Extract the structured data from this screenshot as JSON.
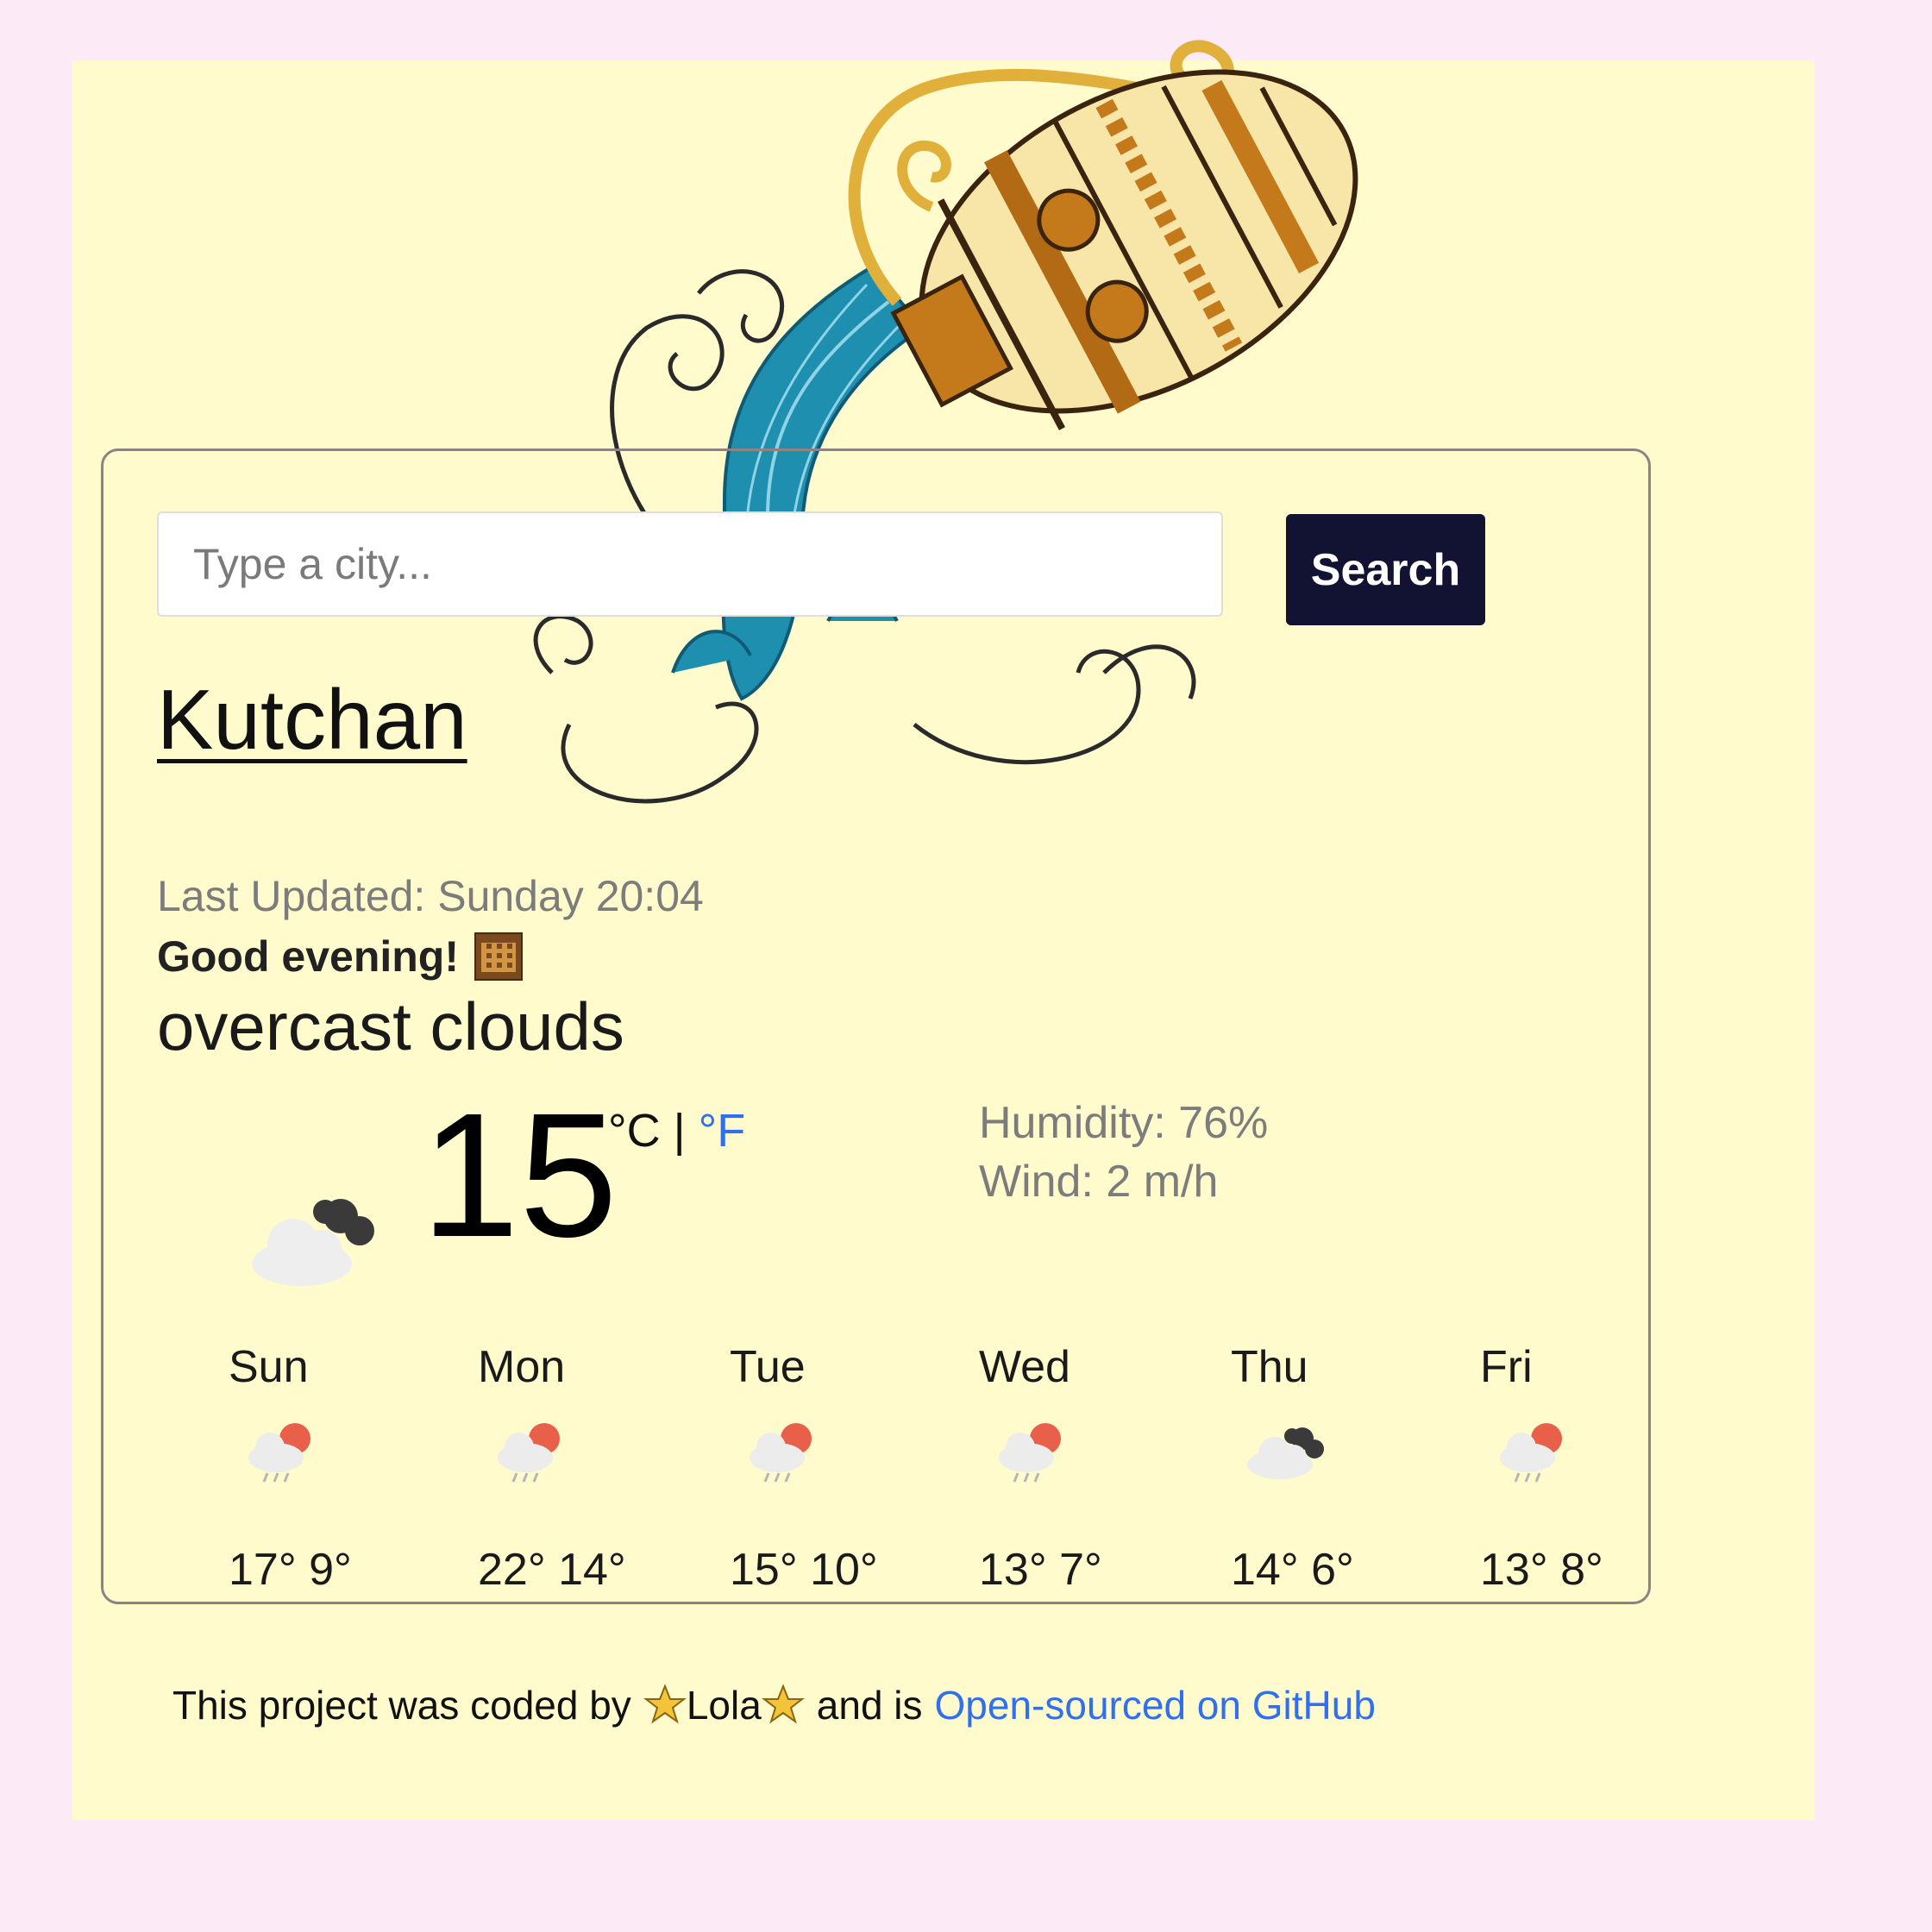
{
  "search": {
    "placeholder": "Type a city...",
    "button_label": "Search"
  },
  "current": {
    "city": "Kutchan",
    "last_updated": "Last Updated: Sunday 20:04",
    "greeting": "Good evening!",
    "greeting_icon": "night-city-emoji",
    "description": "overcast clouds",
    "temperature": "15",
    "unit_c": "°C",
    "unit_separator": "|",
    "unit_f": "°F",
    "humidity": "Humidity: 76%",
    "wind": "Wind: 2 m/h",
    "icon": "overcast-clouds-icon"
  },
  "forecast": [
    {
      "day": "Sun",
      "temps": "17° 9°",
      "icon": "rain-icon"
    },
    {
      "day": "Mon",
      "temps": "22° 14°",
      "icon": "rain-icon"
    },
    {
      "day": "Tue",
      "temps": "15° 10°",
      "icon": "rain-icon"
    },
    {
      "day": "Wed",
      "temps": "13° 7°",
      "icon": "rain-icon"
    },
    {
      "day": "Thu",
      "temps": "14° 6°",
      "icon": "overcast-clouds-icon"
    },
    {
      "day": "Fri",
      "temps": "13° 8°",
      "icon": "rain-icon"
    }
  ],
  "footer": {
    "text_before": "This project was coded by",
    "author": "Lola",
    "text_after": "and is",
    "link_label": "Open-sourced on GitHub"
  },
  "colors": {
    "page_background": "#fcebf7",
    "panel_background": "#fffbcc",
    "button_background": "#121333",
    "link": "#2f6ff0"
  }
}
